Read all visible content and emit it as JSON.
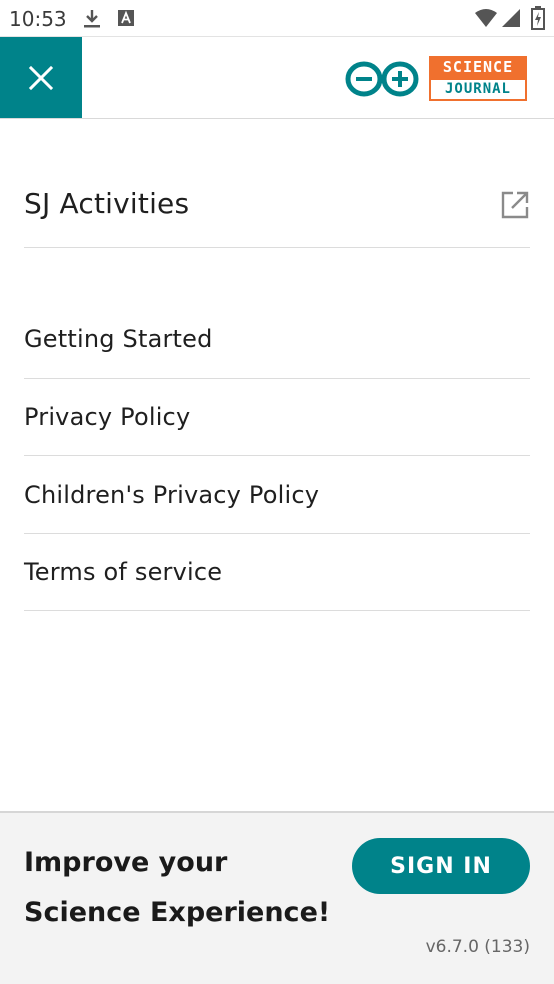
{
  "status_bar": {
    "time": "10:53",
    "icons": [
      "download-icon",
      "font-icon",
      "wifi-icon",
      "signal-icon",
      "battery-icon"
    ]
  },
  "header": {
    "close_icon": "close-icon",
    "logo": {
      "line1": "SCIENCE",
      "line2": "JOURNAL"
    }
  },
  "menu": {
    "activities": {
      "label": "SJ Activities",
      "icon": "external-link-icon"
    },
    "items": [
      {
        "label": "Getting Started"
      },
      {
        "label": "Privacy Policy"
      },
      {
        "label": "Children's Privacy Policy"
      },
      {
        "label": "Terms of service"
      }
    ]
  },
  "footer": {
    "promo_line1": "Improve your",
    "promo_line2": "Science Experience!",
    "sign_in_label": "SIGN IN",
    "version": "v6.7.0 (133)"
  },
  "colors": {
    "accent": "#00838a",
    "logo_orange": "#f0702e",
    "footer_bg": "#f3f3f3"
  }
}
